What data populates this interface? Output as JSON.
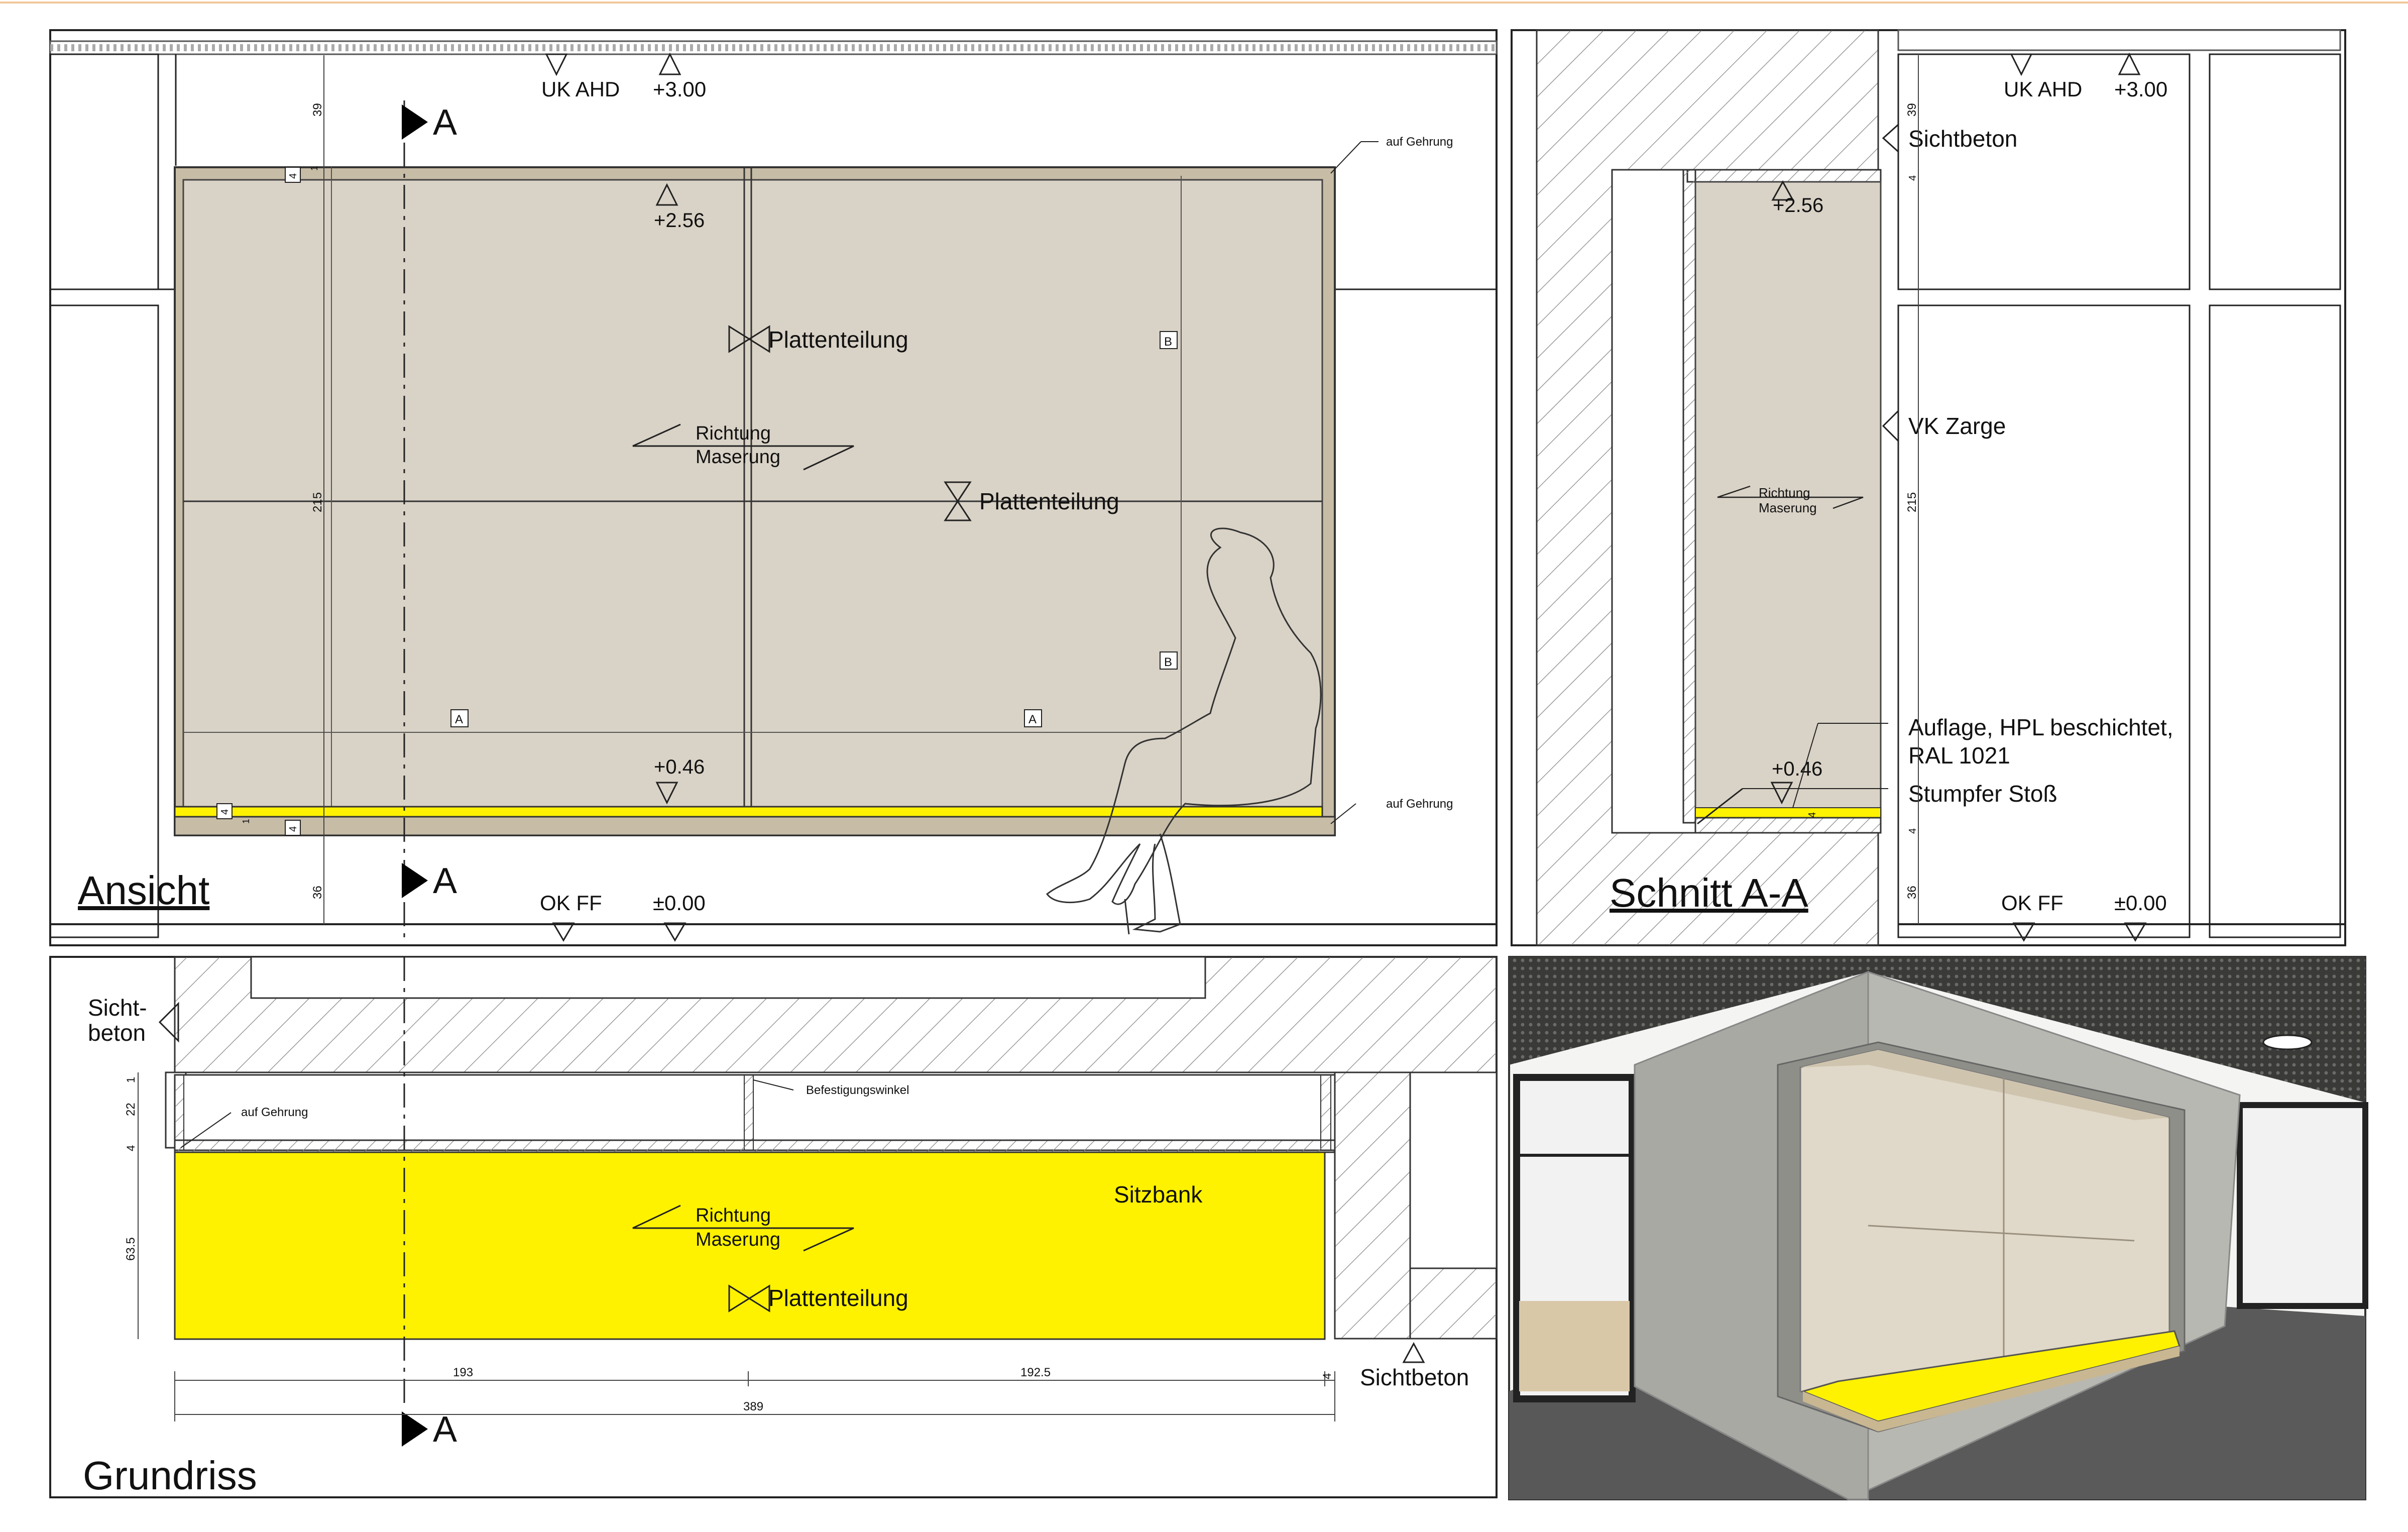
{
  "views": {
    "ansicht": {
      "title": "Ansicht",
      "section_marker": "A",
      "levels": {
        "uk_ahd": "UK AHD",
        "plus300": "+3.00",
        "plus256": "+2.56",
        "plus046": "+0.46",
        "ok_ff": "OK FF",
        "pm000": "±0.00"
      },
      "labels": {
        "plattenteilung": "Plattenteilung",
        "richtung": "Richtung",
        "maserung": "Maserung",
        "auf_gehrung": "auf Gehrung",
        "grid_a": "A",
        "grid_b": "B"
      },
      "dims": {
        "d39": "39",
        "d215": "215",
        "d36": "36",
        "d4": "4",
        "d1": "1"
      }
    },
    "schnitt": {
      "title": "Schnitt A-A",
      "levels": {
        "uk_ahd": "UK AHD",
        "plus300": "+3.00",
        "plus256": "+2.56",
        "plus046": "+0.46",
        "ok_ff": "OK FF",
        "pm000": "±0.00"
      },
      "labels": {
        "sichtbeton": "Sichtbeton",
        "vk_zarge": "VK Zarge",
        "auflage_1": "Auflage, HPL beschichtet,",
        "auflage_2": "RAL 1021",
        "stumpfer_stoss": "Stumpfer Stoß",
        "richtung": "Richtung",
        "maserung": "Maserung"
      },
      "dims": {
        "d39": "39",
        "d215": "215",
        "d36": "36",
        "d4": "4"
      }
    },
    "grundriss": {
      "title": "Grundriss",
      "section_marker": "A",
      "labels": {
        "sicht": "Sicht-",
        "beton": "beton",
        "auf_gehrung": "auf Gehrung",
        "befestigungswinkel": "Befestigungswinkel",
        "sitzbank": "Sitzbank",
        "richtung": "Richtung",
        "maserung": "Maserung",
        "plattenteilung": "Plattenteilung",
        "sichtbeton": "Sichtbeton"
      },
      "dims": {
        "d1": "1",
        "d22": "22",
        "d4": "4",
        "d635": "63.5",
        "d193": "193",
        "d1925": "192.5",
        "d389": "389"
      }
    }
  },
  "colors": {
    "wood_panel": "#d9d2c6",
    "wood_frame": "#c7bca6",
    "seat_yellow": "#fff200",
    "concrete_render": "#b8b8b2",
    "ceiling_render": "#3c3c3a",
    "floor_render": "#585858"
  }
}
